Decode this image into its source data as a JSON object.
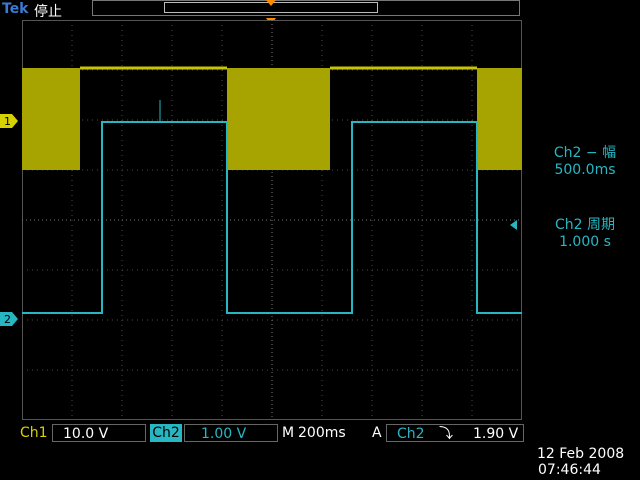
{
  "header": {
    "brand": "Tek",
    "run_state": "停止"
  },
  "channels": {
    "ch1": {
      "label": "Ch1",
      "scale": "10.0 V",
      "marker": "1",
      "color": "#d7d100"
    },
    "ch2": {
      "label": "Ch2",
      "scale": "1.00 V",
      "marker": "2",
      "color": "#27b7c2"
    }
  },
  "horizontal": {
    "label": "M",
    "timebase": "200ms"
  },
  "trigger": {
    "label": "A",
    "source": "Ch2",
    "slope": "⤵",
    "level": "1.90 V"
  },
  "measurements": {
    "m1": {
      "title": "Ch2 − 幅",
      "value": "500.0ms"
    },
    "m2": {
      "title": "Ch2 周期",
      "value": "1.000 s"
    }
  },
  "timestamp": {
    "date": "12 Feb  2008",
    "time": "07:46:44"
  }
}
